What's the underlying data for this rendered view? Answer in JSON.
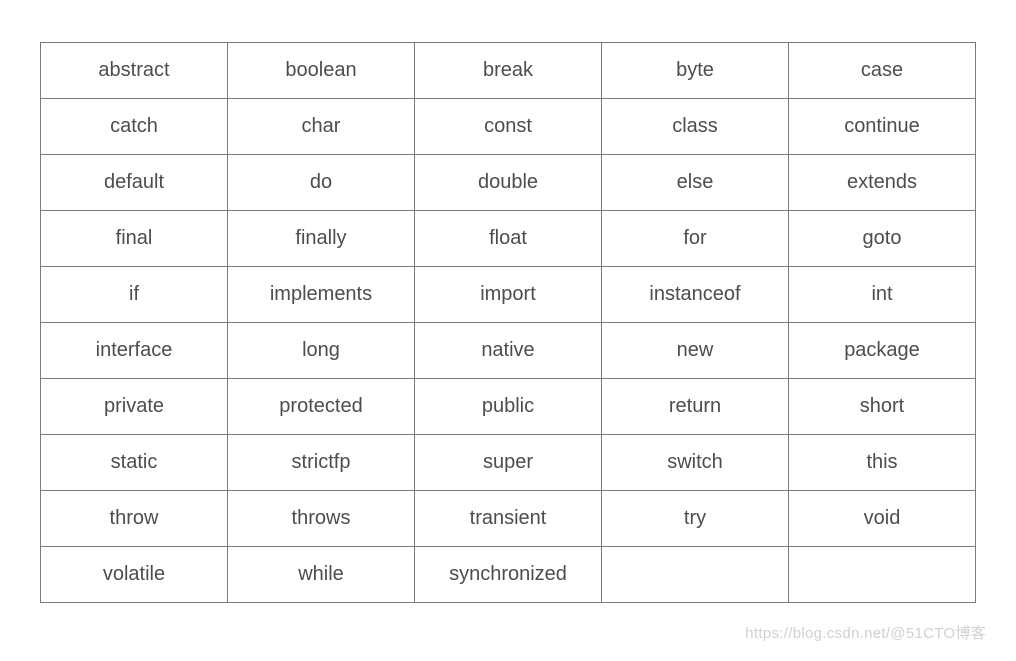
{
  "table": {
    "rows": [
      [
        "abstract",
        "boolean",
        "break",
        "byte",
        "case"
      ],
      [
        "catch",
        "char",
        "const",
        "class",
        "continue"
      ],
      [
        "default",
        "do",
        "double",
        "else",
        "extends"
      ],
      [
        "final",
        "finally",
        "float",
        "for",
        "goto"
      ],
      [
        "if",
        "implements",
        "import",
        "instanceof",
        "int"
      ],
      [
        "interface",
        "long",
        "native",
        "new",
        "package"
      ],
      [
        "private",
        "protected",
        "public",
        "return",
        "short"
      ],
      [
        "static",
        "strictfp",
        "super",
        "switch",
        "this"
      ],
      [
        "throw",
        "throws",
        "transient",
        "try",
        "void"
      ],
      [
        "volatile",
        "while",
        "synchronized",
        "",
        ""
      ]
    ]
  },
  "watermark": "https://blog.csdn.net/@51CTO博客"
}
